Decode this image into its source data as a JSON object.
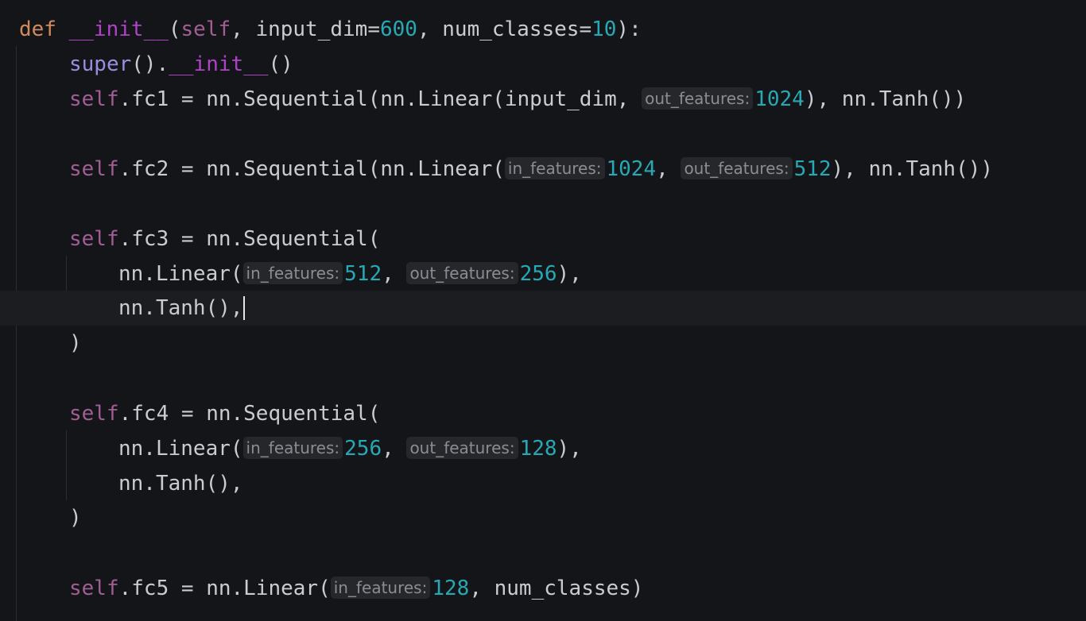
{
  "code": {
    "line1": {
      "def_kw": "def",
      "name": "__init__",
      "open": "(",
      "self": "self",
      "param1": ", input_dim=",
      "val1": "600",
      "param2": ", num_classes=",
      "val2": "10",
      "close": "):"
    },
    "line2": {
      "super": "super",
      "mid": "().",
      "init": "__init__",
      "end": "()"
    },
    "line3": {
      "self": "self",
      "text1": ".fc1 = nn.Sequential(nn.Linear(input_dim, ",
      "hint_out": "out_features:",
      "val": "1024",
      "text2": "), nn.Tanh())"
    },
    "line4": {
      "self": "self",
      "text1": ".fc2 = nn.Sequential(nn.Linear(",
      "hint_in": "in_features:",
      "val_in": "1024",
      "sep": ", ",
      "hint_out": "out_features:",
      "val_out": "512",
      "text2": "), nn.Tanh())"
    },
    "line5": {
      "self": "self",
      "text1": ".fc3 = nn.Sequential("
    },
    "line6": {
      "text1": "nn.Linear(",
      "hint_in": "in_features:",
      "val_in": "512",
      "sep": ", ",
      "hint_out": "out_features:",
      "val_out": "256",
      "text2": "),"
    },
    "line7": {
      "text1": "nn.Tanh(),"
    },
    "line8": {
      "text1": ")"
    },
    "line9": {
      "self": "self",
      "text1": ".fc4 = nn.Sequential("
    },
    "line10": {
      "text1": "nn.Linear(",
      "hint_in": "in_features:",
      "val_in": "256",
      "sep": ", ",
      "hint_out": "out_features:",
      "val_out": "128",
      "text2": "),"
    },
    "line11": {
      "text1": "nn.Tanh(),"
    },
    "line12": {
      "text1": ")"
    },
    "line13": {
      "self": "self",
      "text1": ".fc5 = nn.Linear(",
      "hint_in": "in_features:",
      "val_in": "128",
      "text2": ", num_classes)"
    }
  },
  "colors": {
    "background": "#141518",
    "current_line": "#1c1d21",
    "keyword": "#d18a5e",
    "dunder": "#b042c8",
    "self": "#a25d95",
    "number": "#27a9b5",
    "builtin": "#9b8ee0",
    "text": "#c9ccd1",
    "hint_text": "#8a8d93",
    "hint_bg": "#26272b"
  }
}
